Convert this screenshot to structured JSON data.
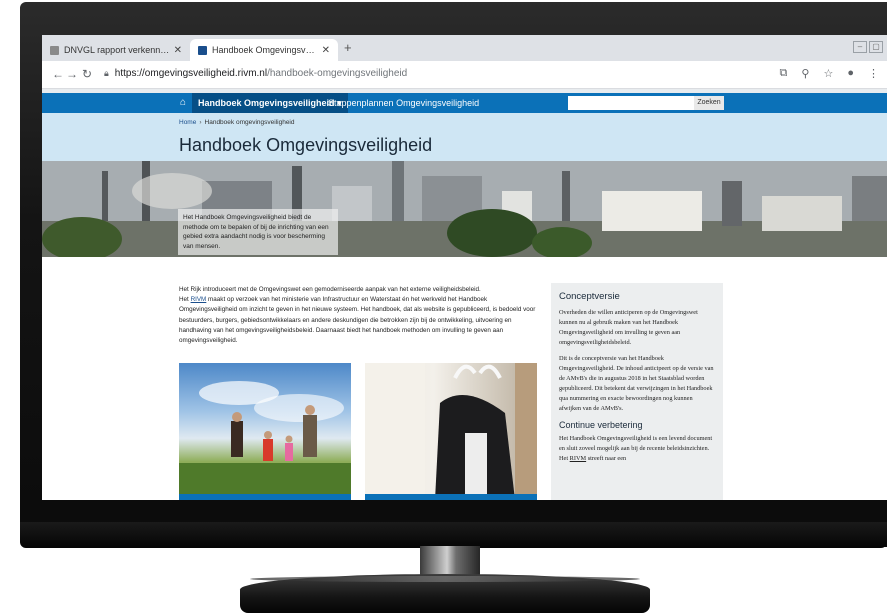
{
  "browser": {
    "tabs": [
      {
        "title": "DNVGL rapport verkenning wate",
        "active": false
      },
      {
        "title": "Handboek Omgevingsveiligheid",
        "active": true
      }
    ],
    "url_host": "https://omgevingsveiligheid.rivm.nl",
    "url_path": "/handboek-omgevingsveiligheid"
  },
  "site": {
    "nav": {
      "active_label": "Handboek Omgevingsveiligheid ▾",
      "second_label": "Stappenplannen Omgevingsveiligheid",
      "search_button": "Zoeken"
    },
    "breadcrumb": {
      "home": "Home",
      "current": "Handboek omgevingsveiligheid"
    },
    "title": "Handboek Omgevingsveiligheid",
    "hero_caption": "Het Handboek Omgevingsveiligheid biedt de methode om te bepalen of bij de inrichting van een gebied extra aandacht nodig is voor bescherming van mensen.",
    "intro": {
      "p1": "Het Rijk introduceert met de Omgevingswet een gemoderniseerde aanpak van het externe veiligheidsbeleid.",
      "p2_before": "Het ",
      "p2_link": "RIVM",
      "p2_after": " maakt op verzoek van het ministerie van Infrastructuur en Waterstaat én het werkveld het Handboek Omgevingsveiligheid om inzicht te geven in het nieuwe systeem. Het handboek, dat als website is gepubliceerd, is bedoeld voor bestuurders, burgers, gebiedsontwikkelaars en andere deskundigen die betrokken zijn bij de ontwikkeling, uitvoering en handhaving van het omgevingsveiligheidsbeleid. Daarnaast biedt het handboek methoden om invulling te geven aan omgevingsveiligheid."
    },
    "aside": {
      "heading1": "Conceptversie",
      "p1": "Overheden die willen anticiperen op de Omgevingswet kunnen nu al gebruik maken van het Handboek Omgevingsveiligheid om invulling te geven aan omgevingsveiligheidsbeleid.",
      "p2": "Dit is de conceptversie van het Handboek Omgevingsveiligheid. De inhoud anticipeert op de versie van de AMvB's die in augustus 2018 in het Staatsblad worden gepubliceerd. Dit betekent dat verwijzingen in het Handboek qua nummering en exacte bewoordingen nog kunnen afwijken van de AMvB's.",
      "heading2": "Continue verbetering",
      "p3_before": "Het Handboek Omgevingsveiligheid is een levend document en sluit zoveel mogelijk aan bij de recente beleidsinzichten. Het ",
      "p3_link": "RIVM",
      "p3_after": " streeft naar een"
    }
  },
  "colors": {
    "nav_blue": "#0b71b8",
    "nav_active": "#064f86",
    "title_band": "#cfe6f4",
    "aside_bg": "#eceeef"
  }
}
